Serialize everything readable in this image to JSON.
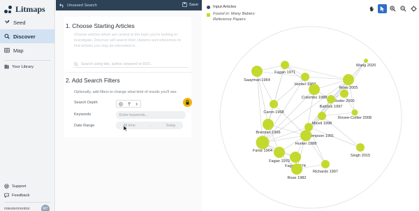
{
  "brand": {
    "name": "Litmaps"
  },
  "sidebar": {
    "items": [
      {
        "label": "Seed",
        "icon": "seed-icon",
        "active": false
      },
      {
        "label": "Discover",
        "icon": "discover-icon",
        "active": true
      },
      {
        "label": "Map",
        "icon": "map-icon",
        "active": false
      }
    ],
    "library": {
      "label": "Your Library",
      "icon": "library-icon"
    },
    "support": {
      "label": "Support",
      "icon": "support-icon"
    },
    "feedback": {
      "label": "Feedback",
      "icon": "feedback-icon"
    },
    "user": {
      "name": "mtestermonitor",
      "initials": "MT"
    }
  },
  "topbar": {
    "title": "Unsaved Search",
    "save_label": "Save"
  },
  "step1": {
    "title": "1.   Choose Starting Articles",
    "description": "Choose articles which are central to the topic you're looking to investigate. Discover will search their citations and references to find articles you may be interested in.",
    "search_placeholder": "Search using title, author, keyword or DOI..."
  },
  "step2": {
    "title": "2.   Add Search Filters",
    "description": "Optionally, add filters to change what kind of results you'll see.",
    "depth_label": "Search Depth",
    "keywords_label": "Keywords",
    "keywords_placeholder": "Enter keywords...",
    "date_label": "Date Range",
    "date_from": "All time",
    "date_sep": "-",
    "date_to": "Today"
  },
  "graph": {
    "legend_input": "Input Articles",
    "legend_found_line1": "Found in: Many Babies:",
    "legend_found_line2": "Reference Papers",
    "colors": {
      "node": "#c4d92e",
      "input": "#324a60",
      "edge": "#c8ccd0",
      "accent": "#2e6fc6"
    },
    "nodes": [
      {
        "label": "Wang 2020",
        "size": "xs"
      },
      {
        "label": "Fagan 1971",
        "size": "m"
      },
      {
        "label": "Saayman 1964",
        "size": "l"
      },
      {
        "label": "Hunter 1983",
        "size": "m"
      },
      {
        "label": "Rose 2005",
        "size": "l"
      },
      {
        "label": "Colombo 1988",
        "size": "l"
      },
      {
        "label": "Roder 2000",
        "size": "m"
      },
      {
        "label": "Bahrick 1997",
        "size": "m"
      },
      {
        "label": "Caron 1968",
        "size": "m"
      },
      {
        "label": "Rovee-Collier 2008",
        "size": "s"
      },
      {
        "label": "Miceli 1998",
        "size": "m"
      },
      {
        "label": "Brennan 1966",
        "size": "l"
      },
      {
        "label": "Thompson 1991",
        "size": "m"
      },
      {
        "label": "Hunter 1988",
        "size": "l"
      },
      {
        "label": "Fantz 1964",
        "size": "xl"
      },
      {
        "label": "Singh 2015",
        "size": "m"
      },
      {
        "label": "Fagan 1970",
        "size": "l"
      },
      {
        "label": "Fagan 1974",
        "size": "l"
      },
      {
        "label": "Richards 1997",
        "size": "m"
      },
      {
        "label": "Rose 1982",
        "size": "l"
      }
    ]
  }
}
